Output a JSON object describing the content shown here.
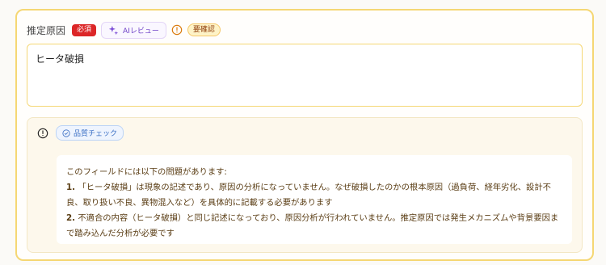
{
  "field": {
    "label": "推定原因",
    "required_badge": "必須",
    "ai_review_label": "AIレビュー",
    "needs_review_badge": "要確認",
    "value": "ヒータ破損"
  },
  "quality_check": {
    "badge_label": "品質チェック",
    "intro": "このフィールドには以下の問題があります:",
    "issues": [
      {
        "num": "1.",
        "text": "「ヒータ破損」は現象の記述であり、原因の分析になっていません。なぜ破損したのかの根本原因（過負荷、経年劣化、設計不良、取り扱い不良、異物混入など）を具体的に記載する必要があります"
      },
      {
        "num": "2.",
        "text": "不適合の内容（ヒータ破損）と同じ記述になっており、原因分析が行われていません。推定原因では発生メカニズムや背景要因まで踏み込んだ分析が必要です"
      }
    ]
  },
  "colors": {
    "accent_border": "#f5d774",
    "required_red": "#dc2626",
    "ai_purple": "#6d3fc6",
    "warning_amber": "#d97706",
    "quality_blue": "#3b6fc4"
  }
}
